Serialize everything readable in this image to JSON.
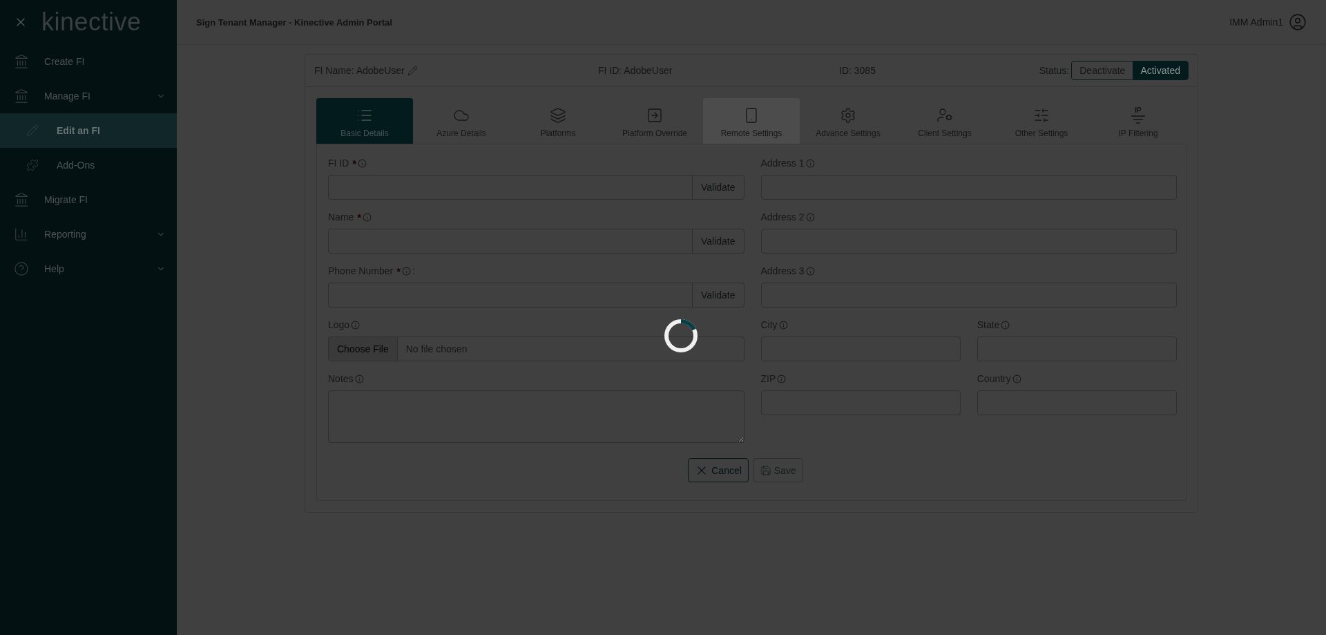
{
  "sidebar": {
    "brand": "kinective",
    "items": [
      {
        "label": "Create FI",
        "selected": false
      },
      {
        "label": "Manage FI",
        "selected": false,
        "kind": "group",
        "expanded": true,
        "children": [
          {
            "label": "Edit an FI",
            "selected": true
          },
          {
            "label": "Add-Ons",
            "selected": false
          }
        ]
      },
      {
        "label": "Migrate FI",
        "selected": false
      },
      {
        "label": "Reporting",
        "selected": false,
        "kind": "group"
      },
      {
        "label": "Help",
        "selected": false,
        "kind": "group"
      }
    ]
  },
  "header": {
    "title": "Sign Tenant Manager - Kinective Admin Portal",
    "user": "IMM Admin1"
  },
  "record": {
    "fi_name": "FI Name: AdobeUser",
    "fi_id": "FI ID: AdobeUser",
    "id": "ID: 3085",
    "status_label": "Status:",
    "status_options": [
      {
        "label": "Deactivate",
        "selected": false
      },
      {
        "label": "Activated",
        "selected": true
      }
    ]
  },
  "tabs": [
    {
      "label": "Basic Details",
      "selected": true,
      "hovered": false
    },
    {
      "label": "Azure Details",
      "selected": false,
      "hovered": false
    },
    {
      "label": "Platforms",
      "selected": false,
      "hovered": false
    },
    {
      "label": "Platform Override",
      "selected": false,
      "hovered": false
    },
    {
      "label": "Remote Settings",
      "selected": false,
      "hovered": true
    },
    {
      "label": "Advance Settings",
      "selected": false,
      "hovered": false
    },
    {
      "label": "Client Settings",
      "selected": false,
      "hovered": false
    },
    {
      "label": "Other Settings",
      "selected": false,
      "hovered": false
    },
    {
      "label": "IP Filtering",
      "selected": false,
      "hovered": false,
      "icon_text": "IP"
    }
  ],
  "left_fields": [
    {
      "kind": "validate",
      "label": "FI ID",
      "required_mark": "*",
      "button": "Validate"
    },
    {
      "kind": "validate",
      "label": "Name",
      "required_mark": "*",
      "button": "Validate"
    },
    {
      "kind": "validate",
      "label": "Phone Number",
      "required_mark": "*",
      "suffix": ":",
      "button": "Validate"
    },
    {
      "kind": "file",
      "label": "Logo",
      "button": "Choose File",
      "value": "No file chosen"
    },
    {
      "kind": "textarea",
      "label": "Notes"
    }
  ],
  "right_fields": [
    {
      "kind": "text",
      "label": "Address 1"
    },
    {
      "kind": "text",
      "label": "Address 2"
    },
    {
      "kind": "text",
      "label": "Address 3"
    },
    {
      "kind": "pair",
      "items": [
        {
          "label": "City"
        },
        {
          "label": "State"
        }
      ]
    },
    {
      "kind": "pair",
      "items": [
        {
          "label": "ZIP"
        },
        {
          "label": "Country"
        }
      ]
    }
  ],
  "actions": [
    {
      "label": "Cancel",
      "disabled": false
    },
    {
      "label": "Save",
      "disabled": true
    }
  ],
  "loading": true
}
